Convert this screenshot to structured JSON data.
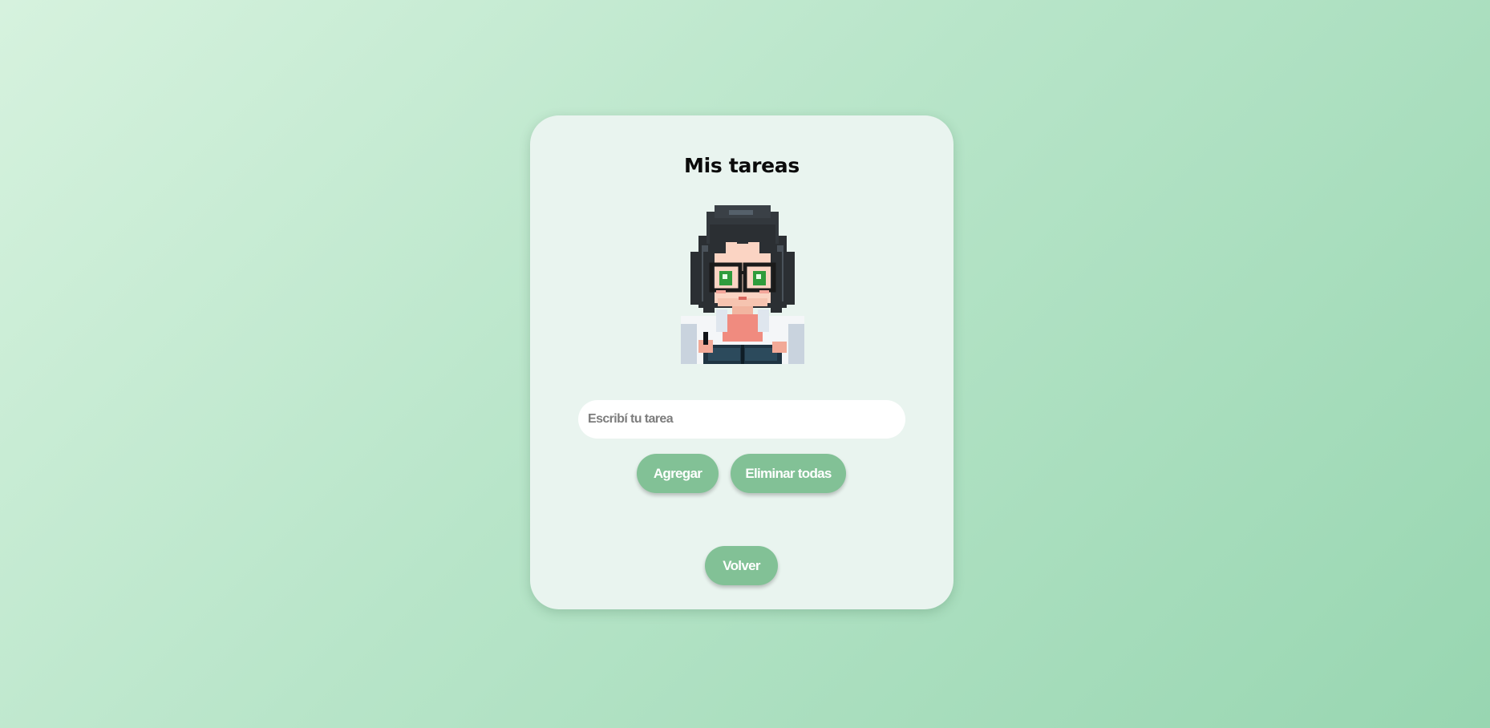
{
  "card": {
    "title": "Mis tareas",
    "avatar": {
      "icon": "pixel-art-girl-with-glasses-writing-notebook-icon"
    }
  },
  "task_form": {
    "input_placeholder": "Escribí tu tarea",
    "input_value": "",
    "add_label": "Agregar",
    "clear_label": "Eliminar todas"
  },
  "tasks": [],
  "nav": {
    "back_label": "Volver"
  },
  "colors": {
    "background_start": "#d6f2de",
    "background_end": "#98d6b1",
    "card": "#e9f4ef",
    "button": "#82c196",
    "button_text": "#ffffff"
  }
}
